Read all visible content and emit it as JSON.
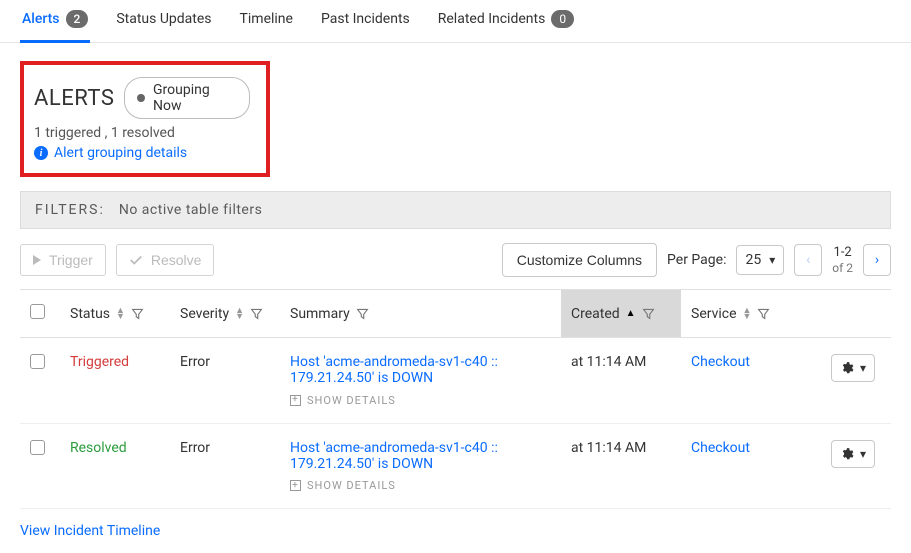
{
  "tabs": [
    {
      "label": "Alerts",
      "badge": "2",
      "active": true
    },
    {
      "label": "Status Updates"
    },
    {
      "label": "Timeline"
    },
    {
      "label": "Past Incidents"
    },
    {
      "label": "Related Incidents",
      "badge": "0"
    }
  ],
  "header": {
    "title": "ALERTS",
    "grouping_pill": "Grouping Now",
    "summary": "1 triggered , 1 resolved",
    "details_link": "Alert grouping details"
  },
  "filters": {
    "label": "FILTERS:",
    "status": "No active table filters"
  },
  "actions": {
    "trigger": "Trigger",
    "resolve": "Resolve",
    "customize": "Customize Columns",
    "per_page_label": "Per Page:",
    "per_page_value": "25",
    "range": "1-2",
    "range_of": "of 2"
  },
  "columns": {
    "status": "Status",
    "severity": "Severity",
    "summary": "Summary",
    "created": "Created",
    "service": "Service"
  },
  "rows": [
    {
      "status": "Triggered",
      "status_class": "triggered",
      "severity": "Error",
      "summary": "Host 'acme-andromeda-sv1-c40 :: 179.21.24.50' is DOWN",
      "created": "at 11:14 AM",
      "service": "Checkout"
    },
    {
      "status": "Resolved",
      "status_class": "resolved",
      "severity": "Error",
      "summary": "Host 'acme-andromeda-sv1-c40 :: 179.21.24.50' is DOWN",
      "created": "at 11:14 AM",
      "service": "Checkout"
    }
  ],
  "show_details": "SHOW DETAILS",
  "footer_link": "View Incident Timeline"
}
